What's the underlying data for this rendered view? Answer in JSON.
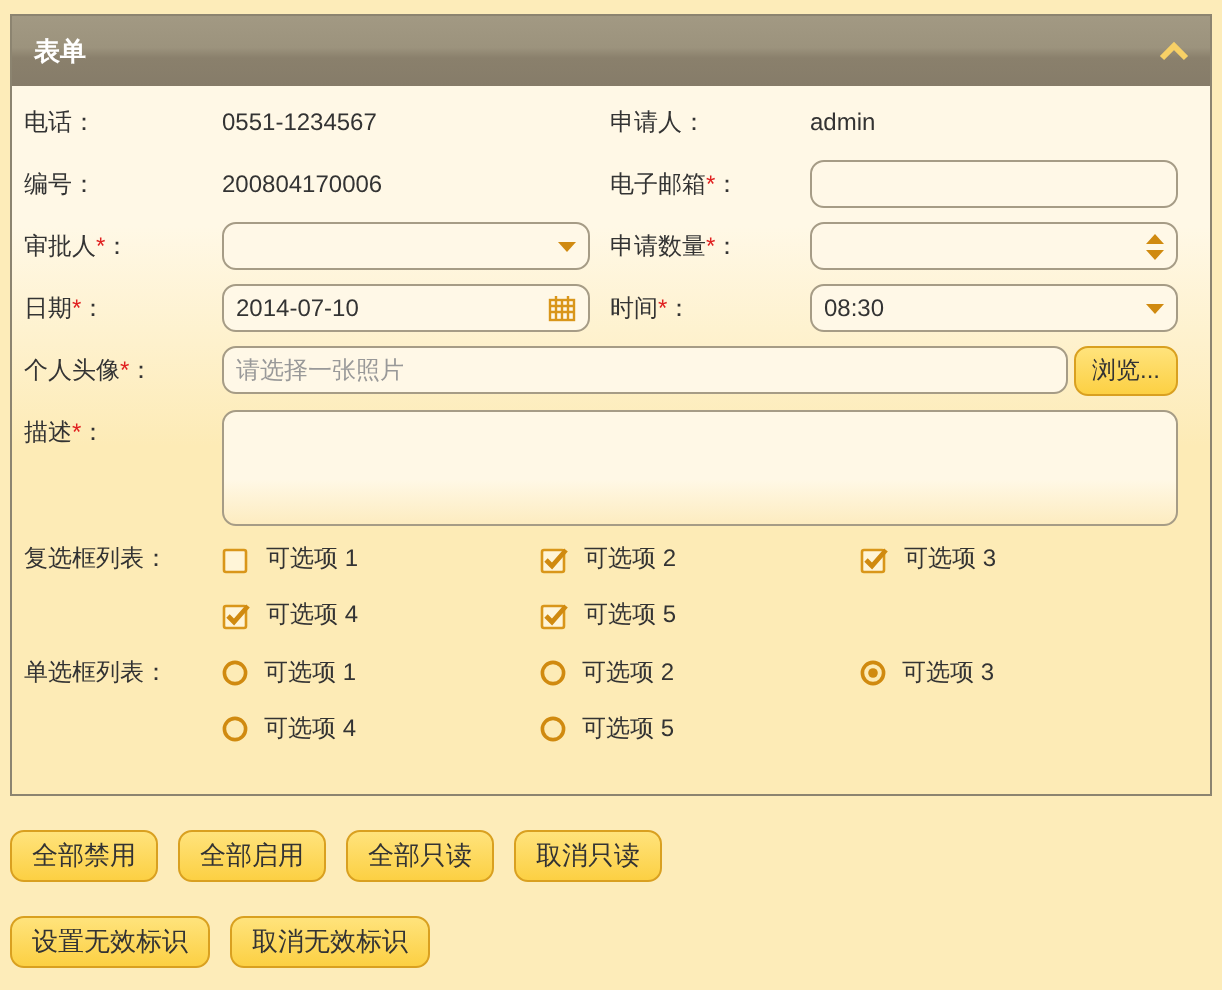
{
  "panel": {
    "title": "表单",
    "collapsed": false
  },
  "rows": [
    {
      "cells": [
        {
          "kind": "text",
          "label": "电话：",
          "value": "0551-1234567"
        },
        {
          "kind": "text",
          "label": "申请人：",
          "value": "admin"
        }
      ]
    },
    {
      "cells": [
        {
          "kind": "text",
          "label": "编号：",
          "value": "200804170006"
        },
        {
          "kind": "input",
          "label": "电子邮箱",
          "required_mark": "*",
          "colon": "："
        }
      ]
    },
    {
      "cells": [
        {
          "kind": "select",
          "label": "审批人",
          "required_mark": "*",
          "colon": "："
        },
        {
          "kind": "spinner",
          "label": "申请数量",
          "required_mark": "*",
          "colon": "："
        }
      ]
    },
    {
      "cells": [
        {
          "kind": "date",
          "label": "日期",
          "required_mark": "*",
          "colon": "：",
          "value": "2014-07-10"
        },
        {
          "kind": "select",
          "label": "时间",
          "required_mark": "*",
          "colon": "：",
          "value": "08:30"
        }
      ]
    },
    {
      "cells": [
        {
          "kind": "file",
          "label": "个人头像",
          "required_mark": "*",
          "colon": "：",
          "placeholder": "请选择一张照片",
          "button": "浏览..."
        }
      ]
    },
    {
      "cells": [
        {
          "kind": "textarea",
          "label": "描述",
          "required_mark": "*",
          "colon": "："
        }
      ]
    },
    {
      "cells": [
        {
          "kind": "checkboxes",
          "label": "复选框列表：",
          "options": [
            {
              "label": "可选项 1",
              "checked": false
            },
            {
              "label": "可选项 2",
              "checked": true
            },
            {
              "label": "可选项 3",
              "checked": true
            },
            {
              "label": "可选项 4",
              "checked": true
            },
            {
              "label": "可选项 5",
              "checked": true
            }
          ]
        }
      ]
    },
    {
      "cells": [
        {
          "kind": "radios",
          "label": "单选框列表：",
          "options": [
            {
              "label": "可选项 1",
              "selected": false
            },
            {
              "label": "可选项 2",
              "selected": false
            },
            {
              "label": "可选项 3",
              "selected": true
            },
            {
              "label": "可选项 4",
              "selected": false
            },
            {
              "label": "可选项 5",
              "selected": false
            }
          ]
        }
      ]
    }
  ],
  "buttons": [
    [
      "全部禁用",
      "全部启用",
      "全部只读",
      "取消只读"
    ],
    [
      "设置无效标识",
      "取消无效标识"
    ]
  ]
}
